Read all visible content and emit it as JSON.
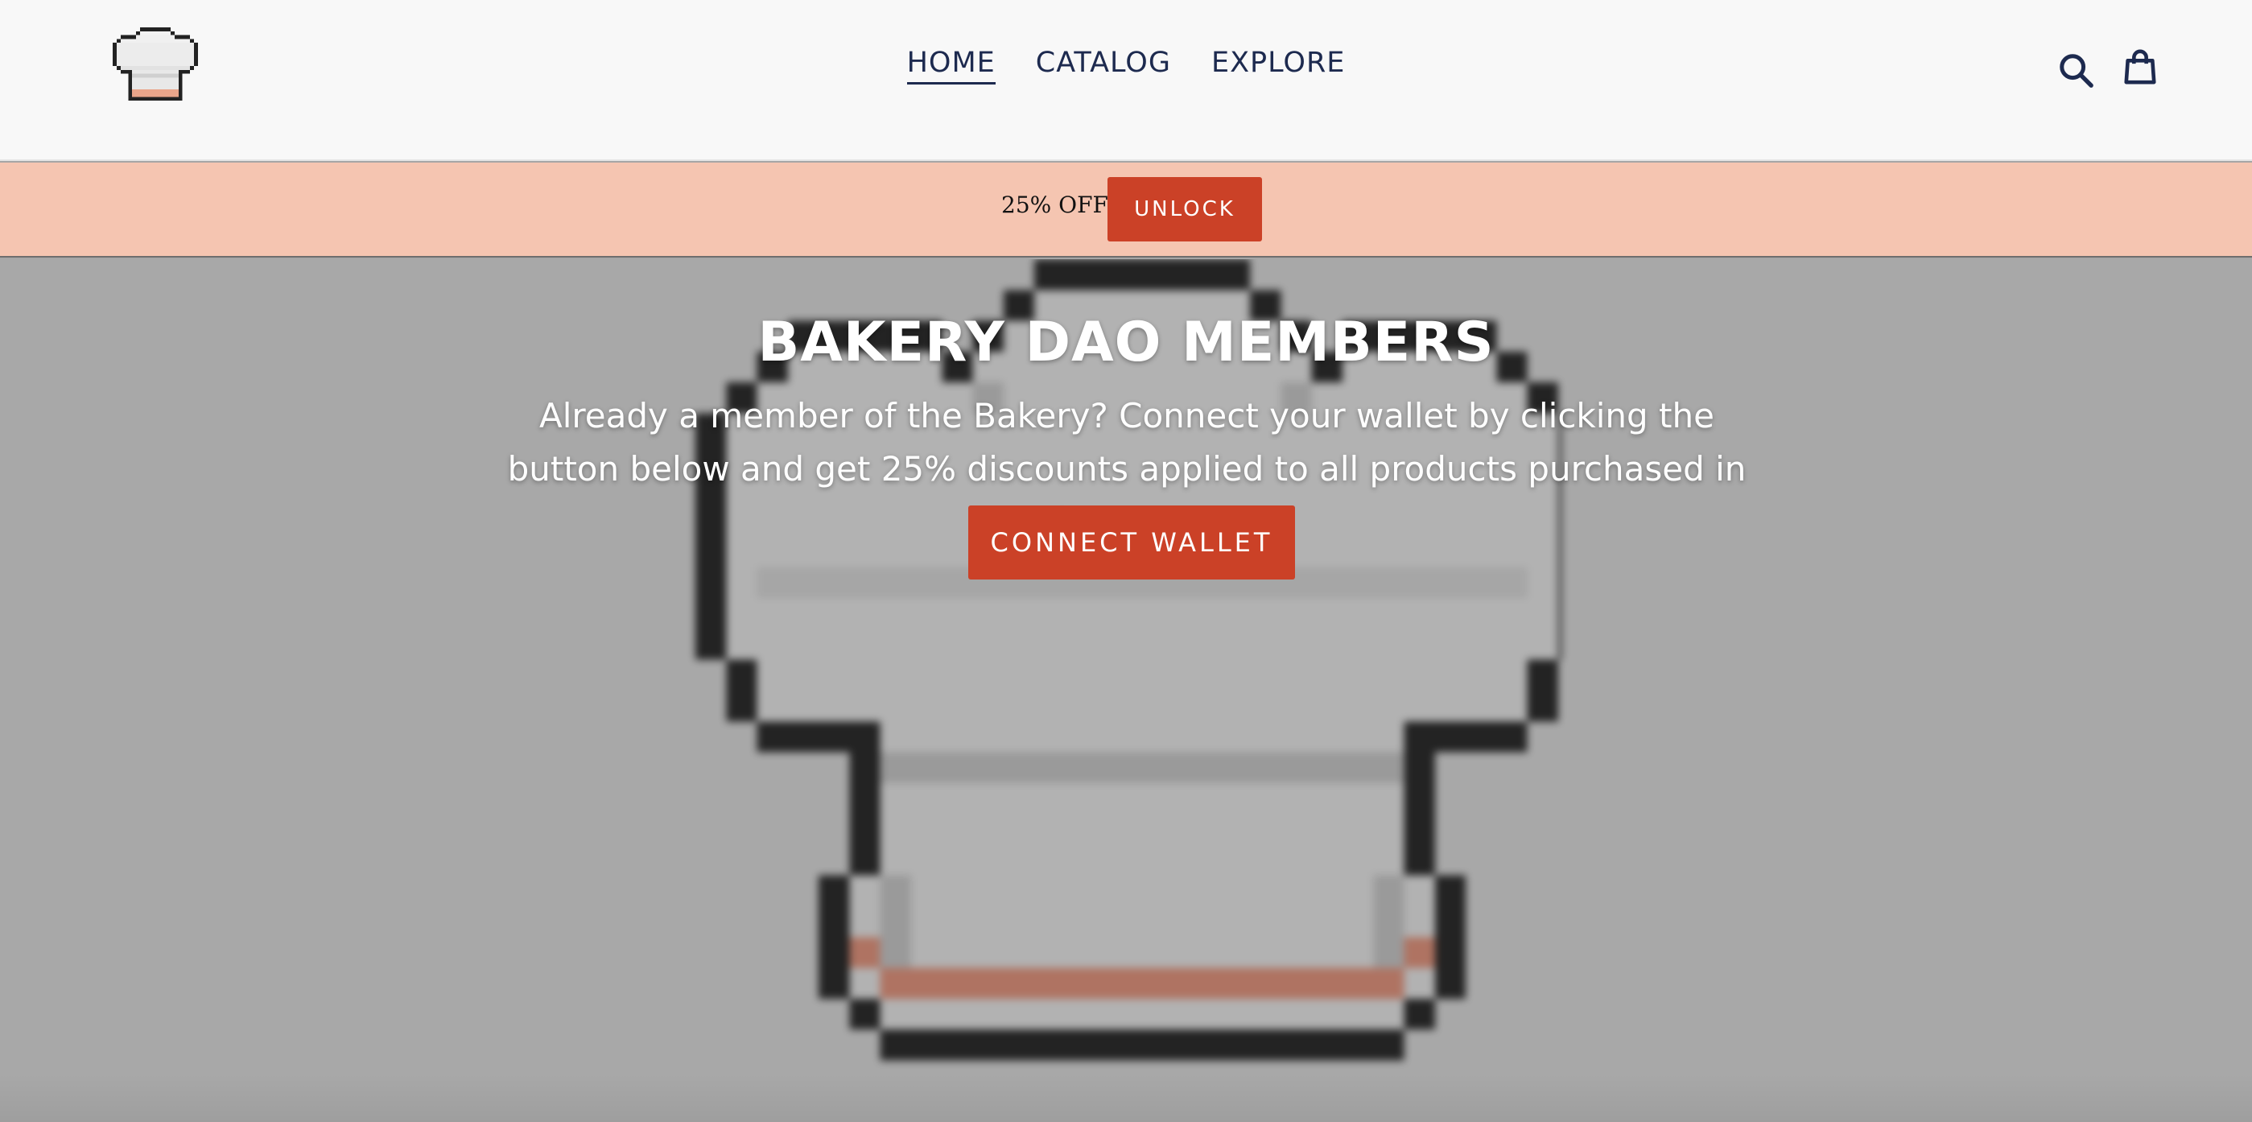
{
  "header": {
    "logo_name": "chef-hat-logo",
    "nav": [
      {
        "label": "HOME",
        "active": true
      },
      {
        "label": "CATALOG",
        "active": false
      },
      {
        "label": "EXPLORE",
        "active": false
      }
    ],
    "icons": [
      "search-icon",
      "cart-icon"
    ]
  },
  "announcement": {
    "text": "25% OFF",
    "button_label": "UNLOCK"
  },
  "hero": {
    "title": "BAKERY DAO MEMBERS",
    "description": "Already a member of the Bakery? Connect your wallet by clicking the button below and get 25% discounts applied to all products purchased in the store!",
    "button_label": "CONNECT WALLET"
  },
  "colors": {
    "accent": "#cb4127",
    "announcement_bg": "#f5c5b1",
    "nav_text": "#1d2a4f",
    "hero_bg": "#a8a8a8"
  }
}
